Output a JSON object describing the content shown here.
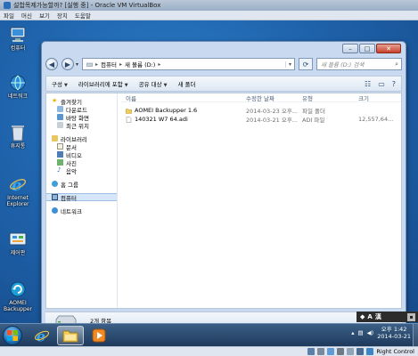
{
  "vbox": {
    "title": "설합목제가능할까? [실행 중] - Oracle VM VirtualBox",
    "menu": [
      "파일",
      "머신",
      "보기",
      "장치",
      "도움말"
    ],
    "host_key": "Right Control"
  },
  "desktop_icons": [
    {
      "label": "컴퓨터",
      "icon": "computer-icon"
    },
    {
      "label": "네트워크",
      "icon": "network-icon"
    },
    {
      "label": "휴지통",
      "icon": "recycle-bin-icon"
    },
    {
      "label": "Internet Explorer",
      "icon": "internet-explorer-icon"
    },
    {
      "label": "제어판",
      "icon": "control-panel-icon"
    },
    {
      "label": "AOMEI Backupper",
      "icon": "aomei-backupper-icon"
    }
  ],
  "explorer": {
    "address_parts": [
      "컴퓨터",
      "새 볼륨 (D:)"
    ],
    "search_placeholder": "새 볼륨 (D:) 검색",
    "commands": [
      "구성",
      "라이브러리에 포함",
      "공유 대상",
      "새 폴더"
    ],
    "nav": {
      "favorites": {
        "label": "즐겨찾기",
        "items": [
          "다운로드",
          "바탕 화면",
          "최근 위치"
        ]
      },
      "libraries": {
        "label": "라이브러리",
        "items": [
          "문서",
          "비디오",
          "사진",
          "음악"
        ]
      },
      "homegroup": "홈 그룹",
      "computer": "컴퓨터",
      "network": "네트워크"
    },
    "columns": {
      "name": "이름",
      "date": "수정한 날짜",
      "type": "유형",
      "size": "크기"
    },
    "files": [
      {
        "name": "AOMEI Backupper 1.6",
        "date": "2014-03-23 오후...",
        "type": "파일 폴더",
        "size": "",
        "icon": "folder-icon"
      },
      {
        "name": "140321 W7 64.adi",
        "date": "2014-03-21 오후...",
        "type": "ADI 파일",
        "size": "12,557,64...",
        "icon": "file-icon"
      }
    ],
    "status": "2개 항목"
  },
  "taskbar": {
    "pinned": [
      "internet-explorer-icon",
      "explorer-icon",
      "media-player-icon"
    ],
    "time": "오후 1:42",
    "date": "2014-03-21"
  },
  "language_bar": {
    "mode": "A",
    "han": "漢"
  }
}
